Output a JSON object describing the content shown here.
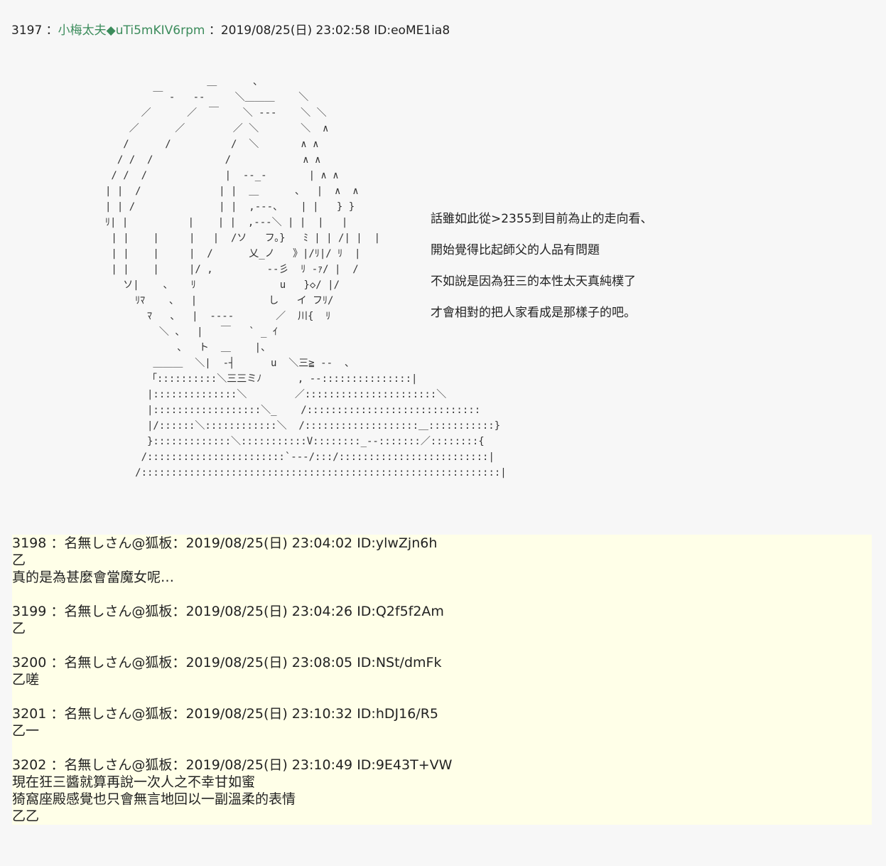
{
  "op": {
    "number": "3197",
    "name": "小梅太夫",
    "trip": "◆uTi5mKIV6rpm",
    "date": "2019/08/25(日) 23:02:58",
    "id": "ID:eoME1ia8",
    "lines": [
      "話雖如此從>2355到目前為止的走向看、",
      "開始覺得比起師父的人品有問題",
      " 不如說是因為狂三的本性太天真純樸了",
      "才會相對的把人家看成是那樣子的吧。"
    ]
  },
  "replies": [
    {
      "number": "3198",
      "name": "名無しさん@狐板",
      "date": "2019/08/25(日) 23:04:02",
      "id": "ID:ylwZjn6h",
      "lines": [
        "乙",
        "真的是為甚麼會當魔女呢…"
      ]
    },
    {
      "number": "3199",
      "name": "名無しさん@狐板",
      "date": "2019/08/25(日) 23:04:26",
      "id": "ID:Q2f5f2Am",
      "lines": [
        "乙"
      ]
    },
    {
      "number": "3200",
      "name": "名無しさん@狐板",
      "date": "2019/08/25(日) 23:08:05",
      "id": "ID:NSt/dmFk",
      "lines": [
        "乙嗟"
      ]
    },
    {
      "number": "3201",
      "name": "名無しさん@狐板",
      "date": "2019/08/25(日) 23:10:32",
      "id": "ID:hDJ16/R5",
      "lines": [
        "乙一"
      ]
    },
    {
      "number": "3202",
      "name": "名無しさん@狐板",
      "date": "2019/08/25(日) 23:10:49",
      "id": "ID:9E43T+VW",
      "lines": [
        "現在狂三醬就算再說一次人之不幸甘如蜜",
        "猗窩座殿感覺也只會無言地回以一副溫柔的表情",
        "乙乙"
      ]
    }
  ]
}
